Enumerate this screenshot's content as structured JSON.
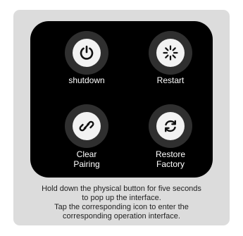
{
  "panel": {
    "actions": [
      {
        "label": "shutdown",
        "icon": "power-icon"
      },
      {
        "label": "Restart",
        "icon": "loading-spinner-icon"
      },
      {
        "label": "Clear\nPairing",
        "icon": "unlink-icon"
      },
      {
        "label": "Restore\nFactory",
        "icon": "refresh-icon"
      }
    ]
  },
  "caption": {
    "lines": [
      "Hold down the physical button for five seconds",
      "to pop up the interface.",
      "Tap the corresponding icon to enter the",
      "corresponding operation interface."
    ]
  }
}
